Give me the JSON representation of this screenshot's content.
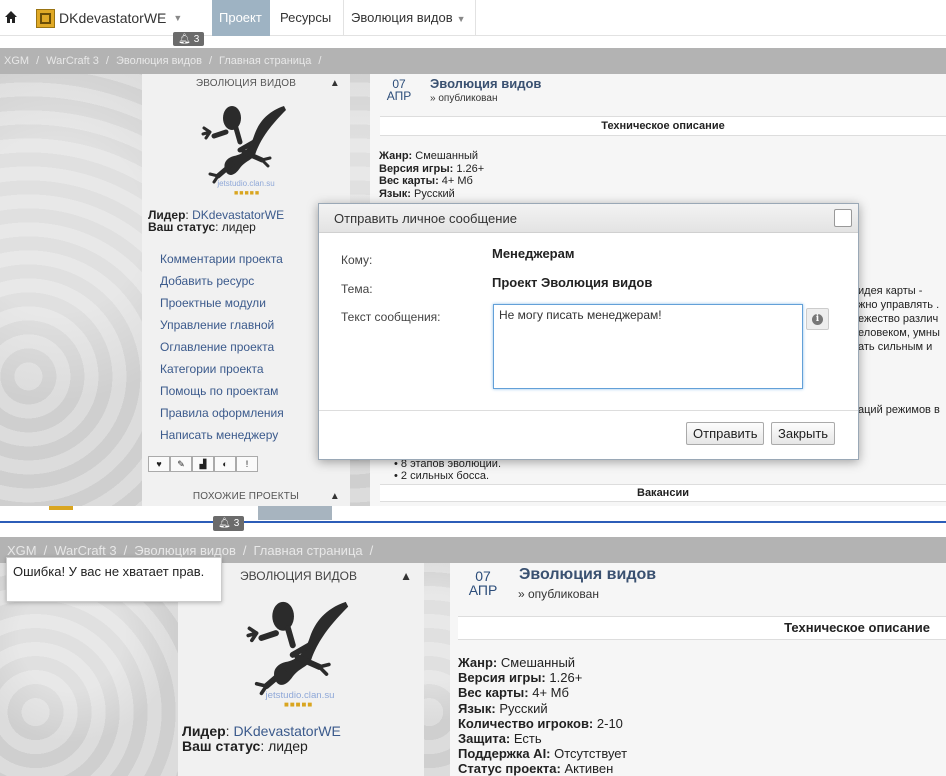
{
  "topnav": {
    "user_name": "DKdevastatorWE",
    "items": [
      "Проект",
      "Ресурсы",
      "Эволюция видов"
    ],
    "notif_count": "3"
  },
  "breadcrumbs": [
    "XGM",
    "WarCraft 3",
    "Эволюция видов",
    "Главная страница"
  ],
  "sidebar": {
    "header": "ЭВОЛЮЦИЯ ВИДОВ",
    "logo_caption": "jetstudio.clan.su",
    "leader_label": "Лидер",
    "leader_name": "DKdevastatorWE",
    "status_label": "Ваш статус",
    "status_value": "лидер",
    "menu": [
      "Комментарии проекта",
      "Добавить ресурс",
      "Проектные модули",
      "Управление главной",
      "Оглавление проекта",
      "Категории проекта",
      "Помощь по проектам",
      "Правила оформления",
      "Написать менеджеру"
    ],
    "tools": [
      "♥",
      "✎",
      "▟",
      "◐",
      "!"
    ],
    "similar_header": "ПОХОЖИЕ ПРОЕКТЫ"
  },
  "post": {
    "day": "07",
    "month": "АПР",
    "title": "Эволюция видов",
    "published": "» опубликован",
    "tech_header": "Техническое описание",
    "vacancy_header": "Вакансии",
    "info_upper": [
      {
        "k": "Жанр:",
        "v": "Смешанный"
      },
      {
        "k": "Версия игры:",
        "v": "1.26+"
      },
      {
        "k": "Вес карты:",
        "v": "4+ Мб"
      },
      {
        "k": "Язык:",
        "v": "Русский"
      }
    ],
    "info_lower": [
      {
        "k": "Жанр:",
        "v": "Смешанный"
      },
      {
        "k": "Версия игры:",
        "v": "1.26+"
      },
      {
        "k": "Вес карты:",
        "v": "4+ Мб"
      },
      {
        "k": "Язык:",
        "v": "Русский"
      },
      {
        "k": "Количество игроков:",
        "v": "2-10"
      },
      {
        "k": "Защита:",
        "v": "Есть"
      },
      {
        "k": "Поддержка AI:",
        "v": "Отсутствует"
      },
      {
        "k": "Статус проекта:",
        "v": "Активен"
      }
    ],
    "desc_right": [
      "идея карты -",
      "жно управлять .",
      "ежество различ",
      "еловеком, умны",
      "ать сильным и"
    ],
    "mode_line": "аций режимов в",
    "bullets": [
      "8 этапов эволюции.",
      "2 сильных босса."
    ]
  },
  "modal": {
    "title": "Отправить личное сообщение",
    "to_label": "Кому:",
    "to_value": "Менеджерам",
    "subject_label": "Тема:",
    "subject_value": "Проект Эволюция видов",
    "text_label": "Текст сообщения:",
    "text_value": "Не могу писать менеджерам!",
    "send": "Отправить",
    "close": "Закрыть"
  },
  "error_tip": "Ошибка! У вас не хватает прав.",
  "colors": {
    "accent": "#9eb3c3",
    "link": "#3b5a8c",
    "title": "#3a5171",
    "divider": "#2c5db8",
    "star": "#d9a520"
  }
}
